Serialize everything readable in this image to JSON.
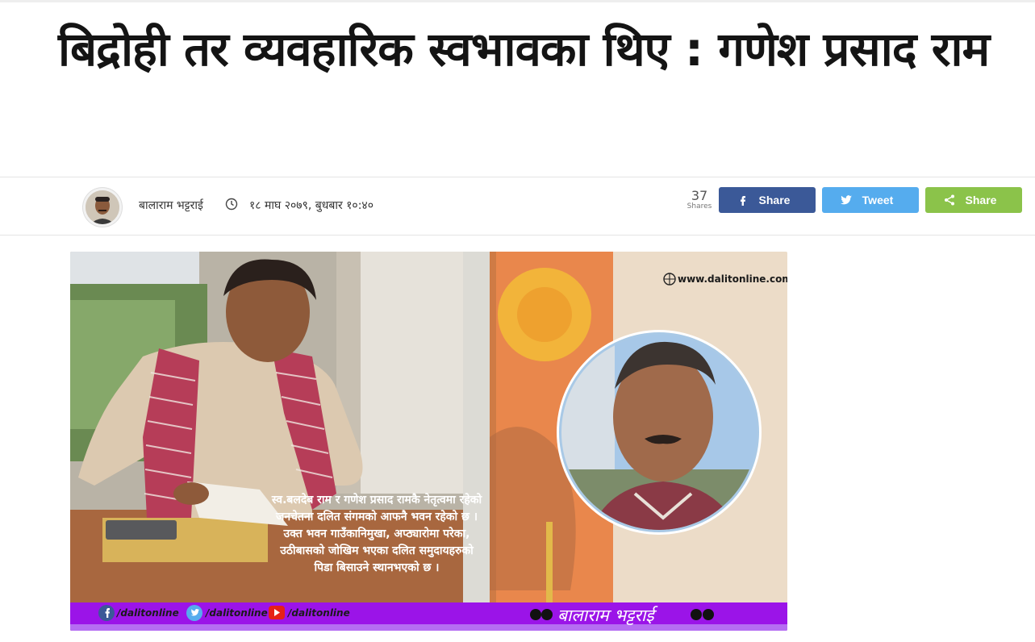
{
  "article": {
    "title": "बिद्रोही तर व्यवहारिक स्वभावका थिए : गणेश प्रसाद राम"
  },
  "meta": {
    "author": "बालाराम भट्टराई",
    "date": "१८ माघ २०७९, बुधबार १०:४०",
    "share_count": "37",
    "share_count_label": "Shares"
  },
  "share_buttons": {
    "facebook": {
      "label": "Share",
      "icon": "facebook-icon",
      "color": "#3b5998"
    },
    "twitter": {
      "label": "Tweet",
      "icon": "twitter-icon",
      "color": "#55acee"
    },
    "generic": {
      "label": "Share",
      "icon": "share-icon",
      "color": "#8bc34a"
    }
  },
  "feature_image": {
    "website": "www.dalitonline.com",
    "caption_lines": [
      "स्व.बलदेब राम र गणेश प्रसाद रामकै नेतृत्वमा रहेको",
      "जनचेतना दलित संगमको आफनै भवन रहेको छ ।",
      "उक्त भवन गाउँकानिमुखा, अप्ठ्यारोमा परेका,",
      "उठीबासको जोखिम भएका दलित समुदायहरुको",
      "पिडा बिसाउने स्थानभएको छ ।"
    ],
    "social_handles": [
      "/dalitonline",
      "/dalitonline",
      "/dalitonline"
    ],
    "author_banner": "बालाराम भट्टराई",
    "colors": {
      "banner": "#9b14e8",
      "accent_orange": "#e9874c"
    }
  }
}
